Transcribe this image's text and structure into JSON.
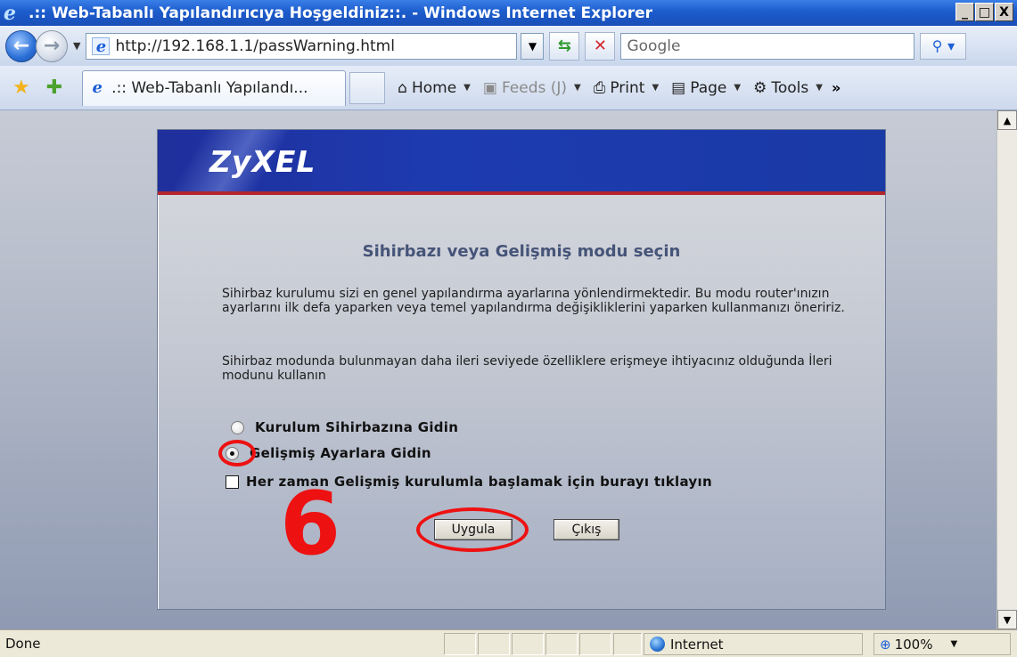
{
  "window": {
    "title": ".:: Web-Tabanlı Yapılandırıcıya Hoşgeldiniz::. - Windows Internet Explorer",
    "buttons": [
      "_",
      "□",
      "X"
    ]
  },
  "navbar": {
    "url": "http://192.168.1.1/passWarning.html",
    "search_placeholder": "Google"
  },
  "tab": {
    "label": ".:: Web-Tabanlı Yapılandı..."
  },
  "commands": [
    {
      "label": "Home",
      "icon": "home-icon"
    },
    {
      "label": "Feeds (J)",
      "icon": "feeds-icon"
    },
    {
      "label": "Print",
      "icon": "printer-icon"
    },
    {
      "label": "Page",
      "icon": "page-icon"
    },
    {
      "label": "Tools",
      "icon": "gear-icon"
    }
  ],
  "page": {
    "logo": "ZyXEL",
    "heading": "Sihirbazı veya Gelişmiş modu seçin",
    "paragraph1": "Sihirbaz kurulumu sizi en genel yapılandırma ayarlarına yönlendirmektedir. Bu modu router'ınızın ayarlarını ilk defa yaparken veya temel yapılandırma değişikliklerini yaparken kullanmanızı öneririz.",
    "paragraph2": "Sihirbaz modunda bulunmayan daha ileri seviyede özelliklere erişmeye ihtiyacınız olduğunda İleri modunu kullanın",
    "option_wizard": "Kurulum Sihirbazına Gidin",
    "option_advanced": "Gelişmiş Ayarlara Gidin",
    "checkbox_always": "Her zaman Gelişmiş kurulumla başlamak için burayı tıklayın",
    "apply_button": "Uygula",
    "exit_button": "Çıkış"
  },
  "annotation": {
    "step_number": "6",
    "color": "#ee1111"
  },
  "statusbar": {
    "status": "Done",
    "zone": "Internet",
    "zoom": "100%"
  }
}
